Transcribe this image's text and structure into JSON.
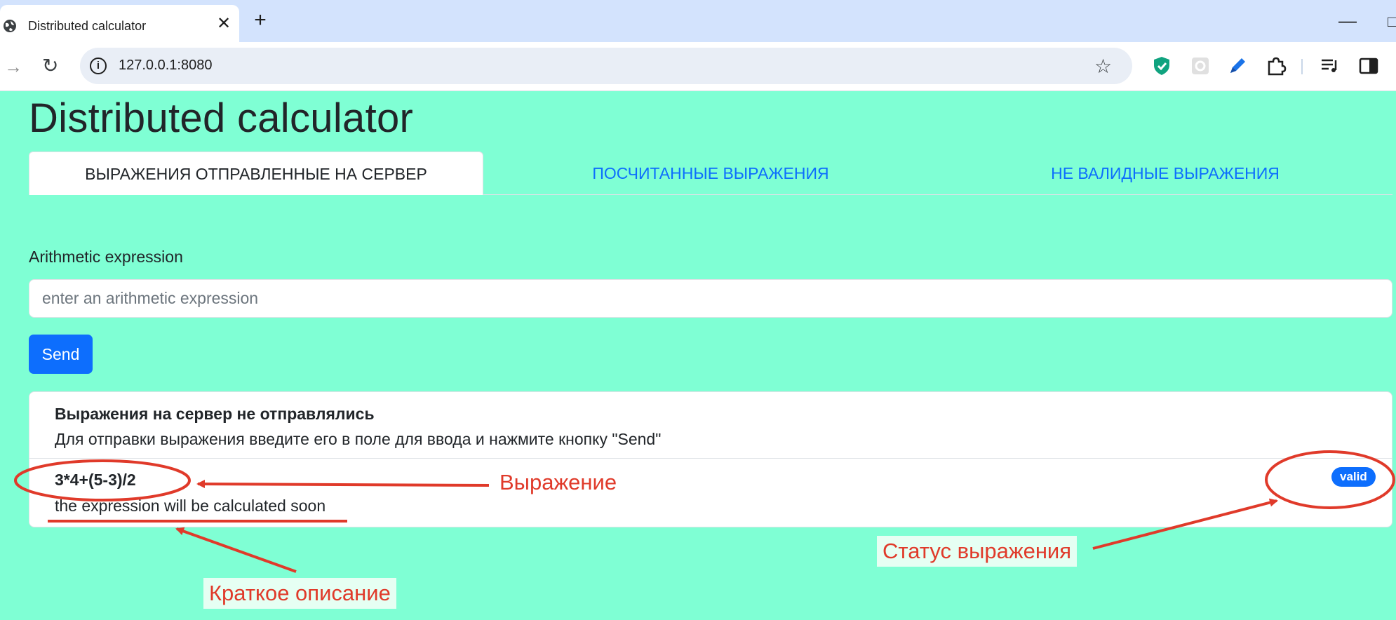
{
  "browser": {
    "tab_title": "Distributed calculator",
    "tab_close": "✕",
    "new_tab": "+",
    "minimize": "—",
    "url": "127.0.0.1:8080"
  },
  "page": {
    "title": "Distributed calculator",
    "tabs": [
      {
        "label": "ВЫРАЖЕНИЯ ОТПРАВЛЕННЫЕ НА СЕРВЕР",
        "active": true
      },
      {
        "label": "ПОСЧИТАННЫЕ ВЫРАЖЕНИЯ",
        "active": false
      },
      {
        "label": "НЕ ВАЛИДНЫЕ ВЫРАЖЕНИЯ",
        "active": false
      }
    ],
    "form": {
      "label": "Arithmetic expression",
      "placeholder": "enter an arithmetic expression",
      "value": "",
      "send_label": "Send"
    },
    "list": {
      "empty_heading": "Выражения на сервер не отправлялись",
      "empty_text": "Для отправки выражения введите его в поле для ввода и нажмите кнопку \"Send\"",
      "items": [
        {
          "expression": "3*4+(5-3)/2",
          "description": "the expression will be calculated soon",
          "status": "valid"
        }
      ]
    }
  },
  "annotations": {
    "expression": "Выражение",
    "status": "Статус выражения",
    "description": "Краткое описание",
    "color": "#e03a2a"
  },
  "colors": {
    "page_bg": "#7fffd4",
    "primary": "#0d6efd",
    "tab_link": "#0d6efd"
  }
}
